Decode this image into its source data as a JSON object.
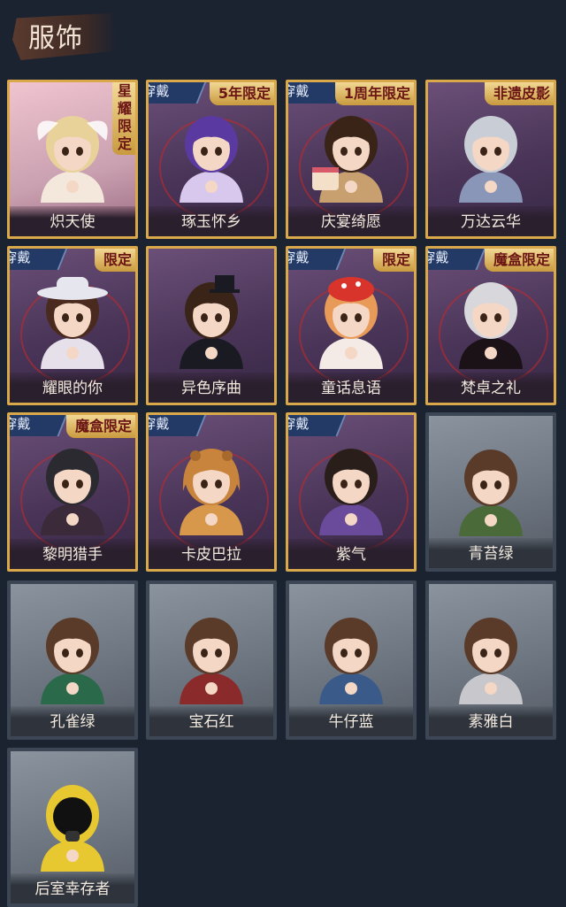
{
  "header": {
    "title": "服饰"
  },
  "wear_label": "穿戴",
  "cards": [
    {
      "name": "炽天使",
      "tag": "星耀限定",
      "tag_style": "vertical",
      "wearing": false,
      "style": "pink",
      "hair": "#e8d29a",
      "outfit": "#f4e8dc",
      "icon": "angel-icon"
    },
    {
      "name": "琢玉怀乡",
      "tag": "5年限定",
      "wearing": true,
      "style": "purple",
      "hair": "#5a3aa0",
      "outfit": "#d9c8ee",
      "icon": "portrait-icon"
    },
    {
      "name": "庆宴绮愿",
      "tag": "1周年限定",
      "wearing": true,
      "style": "purple",
      "hair": "#3a2418",
      "outfit": "#c8a070",
      "icon": "cake-icon"
    },
    {
      "name": "万达云华",
      "tag": "非遗皮影",
      "wearing": false,
      "style": "purple",
      "hair": "#c8cdd6",
      "outfit": "#8a96b8",
      "icon": "portrait-icon"
    },
    {
      "name": "耀眼的你",
      "tag": "限定",
      "wearing": true,
      "style": "purple",
      "hair": "#4a2a1e",
      "outfit": "#e6e0ea",
      "icon": "cowboy-hat-icon"
    },
    {
      "name": "异色序曲",
      "tag": "",
      "wearing": false,
      "style": "purple",
      "hair": "#3a2418",
      "outfit": "#1a1a22",
      "icon": "top-hat-icon"
    },
    {
      "name": "童话息语",
      "tag": "限定",
      "wearing": true,
      "style": "purple",
      "hair": "#e89a58",
      "outfit": "#f4eae6",
      "icon": "mushroom-hat-icon"
    },
    {
      "name": "梵卓之礼",
      "tag": "魔盒限定",
      "wearing": true,
      "style": "purple",
      "hair": "#d8d8dc",
      "outfit": "#1a1216",
      "icon": "portrait-icon"
    },
    {
      "name": "黎明猎手",
      "tag": "魔盒限定",
      "wearing": true,
      "style": "purple",
      "hair": "#2a2a30",
      "outfit": "#3a2a3a",
      "icon": "portrait-icon"
    },
    {
      "name": "卡皮巴拉",
      "tag": "",
      "wearing": true,
      "style": "purple",
      "hair": "#c8843c",
      "outfit": "#d8984c",
      "icon": "capybara-hood-icon"
    },
    {
      "name": "紫气",
      "tag": "",
      "wearing": true,
      "style": "purple",
      "hair": "#2a1e1a",
      "outfit": "#6a4a9a",
      "icon": "portrait-icon"
    },
    {
      "name": "青苔绿",
      "tag": "",
      "wearing": false,
      "style": "gray",
      "hair": "#5a3a28",
      "outfit": "#4a6a3a",
      "icon": "portrait-icon"
    },
    {
      "name": "孔雀绿",
      "tag": "",
      "wearing": false,
      "style": "gray",
      "hair": "#5a3a28",
      "outfit": "#2a6a4a",
      "icon": "portrait-icon"
    },
    {
      "name": "宝石红",
      "tag": "",
      "wearing": false,
      "style": "gray",
      "hair": "#5a3a28",
      "outfit": "#8a2a2a",
      "icon": "portrait-icon"
    },
    {
      "name": "牛仔蓝",
      "tag": "",
      "wearing": false,
      "style": "gray",
      "hair": "#5a3a28",
      "outfit": "#3a5a8a",
      "icon": "portrait-icon"
    },
    {
      "name": "素雅白",
      "tag": "",
      "wearing": false,
      "style": "gray",
      "hair": "#5a3a28",
      "outfit": "#c8c8cc",
      "icon": "portrait-icon"
    },
    {
      "name": "后室幸存者",
      "tag": "",
      "wearing": false,
      "style": "gray",
      "hair": "#e8c830",
      "outfit": "#e8c830",
      "icon": "hazmat-suit-icon"
    }
  ],
  "colors": {
    "gold_border": "#d9a84a",
    "gray_border": "#3c4654",
    "badge": "#243a66",
    "background": "#1b2230"
  }
}
